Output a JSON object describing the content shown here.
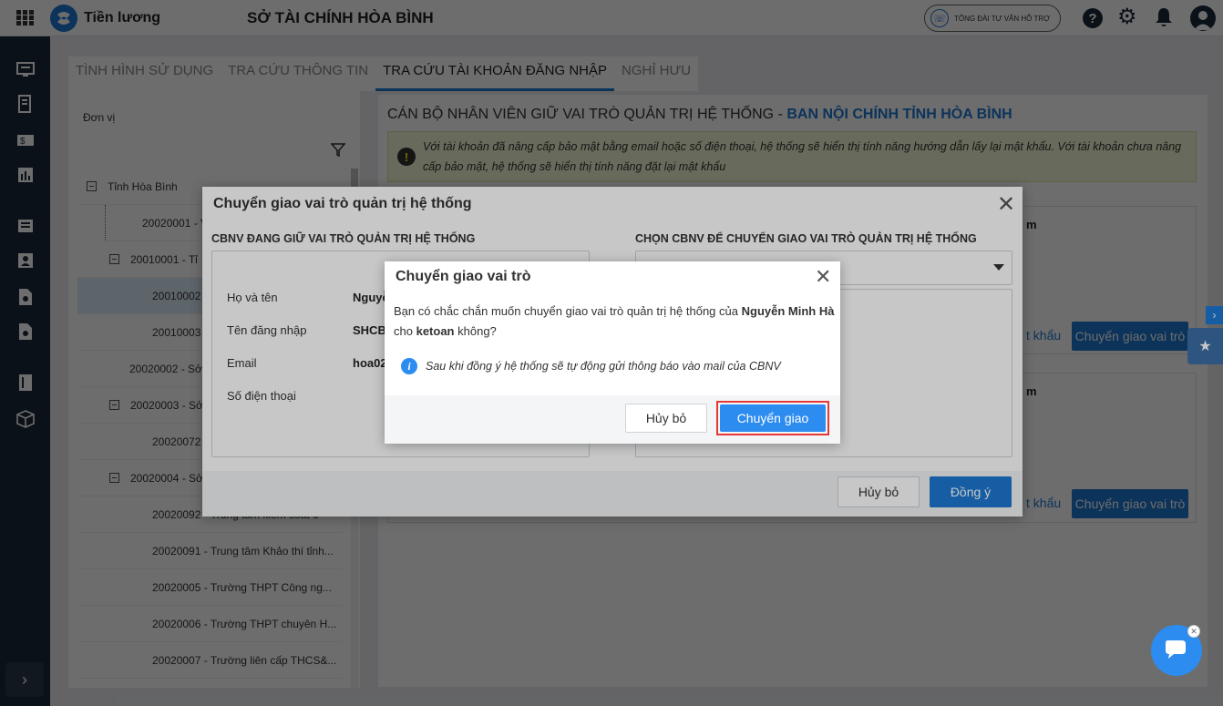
{
  "app": {
    "name": "Tiền lương",
    "org": "SỞ TÀI CHÍNH HÒA BÌNH",
    "support": "TỔNG ĐÀI TƯ VẤN HỖ TRỢ"
  },
  "sidebar_icons": [
    "monitor-icon",
    "invoice-icon",
    "money-icon",
    "bar-chart-icon",
    "list-icon",
    "user-card-icon",
    "doc-settings-icon",
    "doc-gear-icon",
    "book-icon",
    "box-icon",
    "expand-icon"
  ],
  "tabs": [
    "TÌNH HÌNH SỬ DỤNG",
    "TRA CỨU THÔNG TIN",
    "TRA CỨU TÀI KHOẢN ĐĂNG NHẬP",
    "NGHỈ HƯU"
  ],
  "left": {
    "unit_label": "Đơn vị",
    "tree": [
      {
        "text": "Tỉnh Hòa Bình",
        "expanded": true
      },
      {
        "text": "20020001 - Vă"
      },
      {
        "text": "20010001 - Tỉ",
        "expanded": true
      },
      {
        "text": "20010002"
      },
      {
        "text": "20010003"
      },
      {
        "text": "20020002 - Sở"
      },
      {
        "text": "20020003 - Sở",
        "expanded": true
      },
      {
        "text": "20020072"
      },
      {
        "text": "20020004 - Sở",
        "expanded": true
      },
      {
        "text": "20020092 - Trung tâm kiểm soát c"
      },
      {
        "text": "20020091 - Trung tâm Khảo thí tỉnh..."
      },
      {
        "text": "20020005 - Trường THPT Công ng..."
      },
      {
        "text": "20020006 - Trường THPT chuyên H..."
      },
      {
        "text": "20020007 - Trường liên cấp THCS&..."
      }
    ]
  },
  "right": {
    "title_prefix": "CÁN BỘ NHÂN VIÊN GIỮ VAI TRÒ QUẢN TRỊ HỆ THỐNG -",
    "title_unit": "BAN NỘI CHÍNH TỈNH HÒA BÌNH",
    "notice": "Với tài khoản đã nâng cấp bảo mật bằng email hoặc số điện thoại, hệ thống sẽ hiển thị tính năng hướng dẫn lấy lại mật khẩu. Với tài khoản chưa nâng cấp bảo mật, hệ thống sẽ hiển thị tính năng đặt lại mật khẩu",
    "card_fragment": "m",
    "reset_fragment": "t khẩu",
    "transfer_label": "Chuyển giao vai trò"
  },
  "modal1": {
    "title": "Chuyển giao vai trò quản trị hệ thống",
    "left_heading": "CBNV ĐANG GIỮ VAI TRÒ QUẢN TRỊ HỆ THỐNG",
    "right_heading": "CHỌN CBNV ĐỂ CHUYỂN GIAO VAI TRÒ QUẢN TRỊ HỆ THỐNG",
    "fields": [
      {
        "label": "Họ và tên",
        "value": "Nguyễ"
      },
      {
        "label": "Tên đăng nhập",
        "value": "SHCB"
      },
      {
        "label": "Email",
        "value": "hoa02"
      },
      {
        "label": "Số điện thoại",
        "value": ""
      }
    ],
    "cancel": "Hủy bỏ",
    "ok": "Đồng ý"
  },
  "modal2": {
    "title": "Chuyển giao vai trò",
    "msg_prefix": "Bạn có chắc chắn muốn chuyển giao vai trò quản trị hệ thống của",
    "msg_name": "Nguyễn Minh Hà",
    "msg_for": "cho",
    "msg_user": "ketoan",
    "msg_suffix": "không?",
    "info": "Sau khi đồng ý hệ thống sẽ tự động gửi thông báo vào mail của CBNV",
    "cancel": "Hủy bỏ",
    "confirm": "Chuyển giao",
    "accent": "#2d8cf0",
    "highlight": "#e53935"
  }
}
